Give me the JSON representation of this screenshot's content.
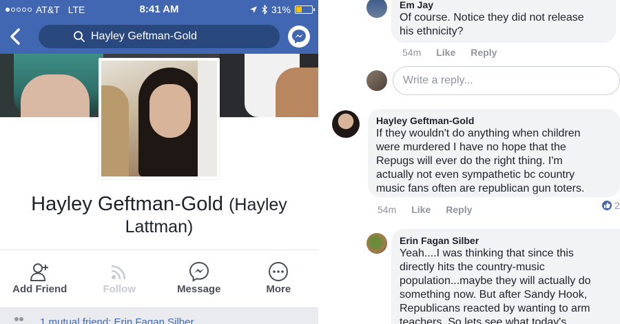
{
  "status_bar": {
    "carrier": "AT&T",
    "network": "LTE",
    "time": "8:41 AM",
    "battery": "31%"
  },
  "navbar": {
    "search_value": "Hayley Geftman-Gold"
  },
  "profile": {
    "name": "Hayley Geftman-Gold",
    "alt_name_part1": "(Hayley",
    "alt_name_part2": "Lattman)"
  },
  "actions": [
    {
      "label": "Add Friend",
      "icon": "add-friend-icon",
      "enabled": true
    },
    {
      "label": "Follow",
      "icon": "follow-icon",
      "enabled": false
    },
    {
      "label": "Message",
      "icon": "messenger-icon",
      "enabled": true
    },
    {
      "label": "More",
      "icon": "more-icon",
      "enabled": true
    }
  ],
  "mutual": {
    "text": "1 mutual friend: Erin Fagan Silber"
  },
  "comments": [
    {
      "author": "Em Jay",
      "lines": [
        "Of course. Notice they did not release",
        "his ethnicity?"
      ],
      "time": "54m",
      "like_label": "Like",
      "reply_label": "Reply"
    },
    {
      "author": "Hayley Geftman-Gold",
      "lines": [
        "If they wouldn't do anything when children",
        "were murdered I have no hope that the",
        "Repugs will ever do the right thing.  I'm",
        "actually not even sympathetic bc country",
        "music fans often are republican gun toters."
      ],
      "time": "54m",
      "like_label": "Like",
      "reply_label": "Reply",
      "reactions": "2"
    },
    {
      "author": "Erin Fagan Silber",
      "lines": [
        "Yeah....I was thinking that since this",
        "directly hits the country-music",
        "population...maybe they will actually do",
        "something now.  But after Sandy Hook,",
        "Republicans reacted by wanting to arm",
        "teachers.  So lets see what today's"
      ]
    }
  ],
  "reply_placeholder": "Write a reply...",
  "colors": {
    "facebook_blue": "#4267b2",
    "bubble_gray": "#f2f3f5",
    "meta_gray": "#90949c"
  }
}
